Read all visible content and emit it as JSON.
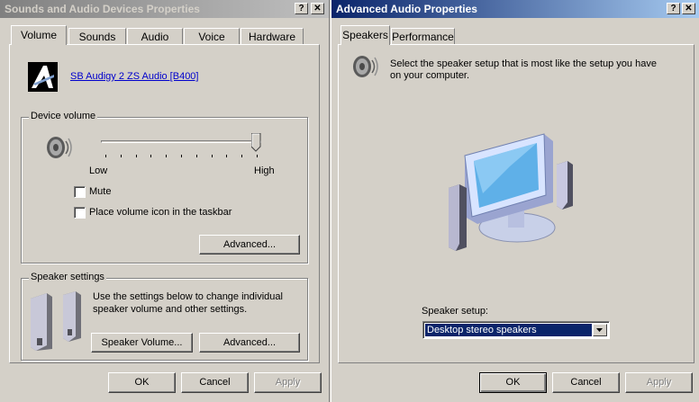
{
  "left_window": {
    "title": "Sounds and Audio Devices Properties",
    "help_btn": "?",
    "close_btn": "✕",
    "tabs": [
      "Volume",
      "Sounds",
      "Audio",
      "Voice",
      "Hardware"
    ],
    "device_link": "SB Audigy 2 ZS Audio [B400]",
    "device_volume": {
      "group_label": "Device volume",
      "low_label": "Low",
      "high_label": "High",
      "level": 1.0,
      "mute_label": "Mute",
      "place_icon_label": "Place volume icon in the taskbar",
      "advanced_button": "Advanced..."
    },
    "speaker_settings": {
      "group_label": "Speaker settings",
      "description_line1": "Use the settings below to change individual",
      "description_line2": "speaker volume and other settings.",
      "speaker_volume_button": "Speaker Volume...",
      "advanced_button": "Advanced..."
    },
    "buttons": {
      "ok": "OK",
      "cancel": "Cancel",
      "apply": "Apply"
    }
  },
  "right_window": {
    "title": "Advanced Audio Properties",
    "help_btn": "?",
    "close_btn": "✕",
    "tabs": [
      "Speakers",
      "Performance"
    ],
    "description_line1": "Select the speaker setup that is most like the setup you have",
    "description_line2": "on your computer.",
    "speaker_setup_label": "Speaker setup:",
    "speaker_setup_value": "Desktop stereo speakers",
    "buttons": {
      "ok": "OK",
      "cancel": "Cancel",
      "apply": "Apply"
    }
  },
  "colors": {
    "active_title": "#0a246a",
    "inactive_title": "#808080",
    "selection": "#0a246a",
    "link": "#0000cc",
    "face": "#d4d0c8"
  }
}
